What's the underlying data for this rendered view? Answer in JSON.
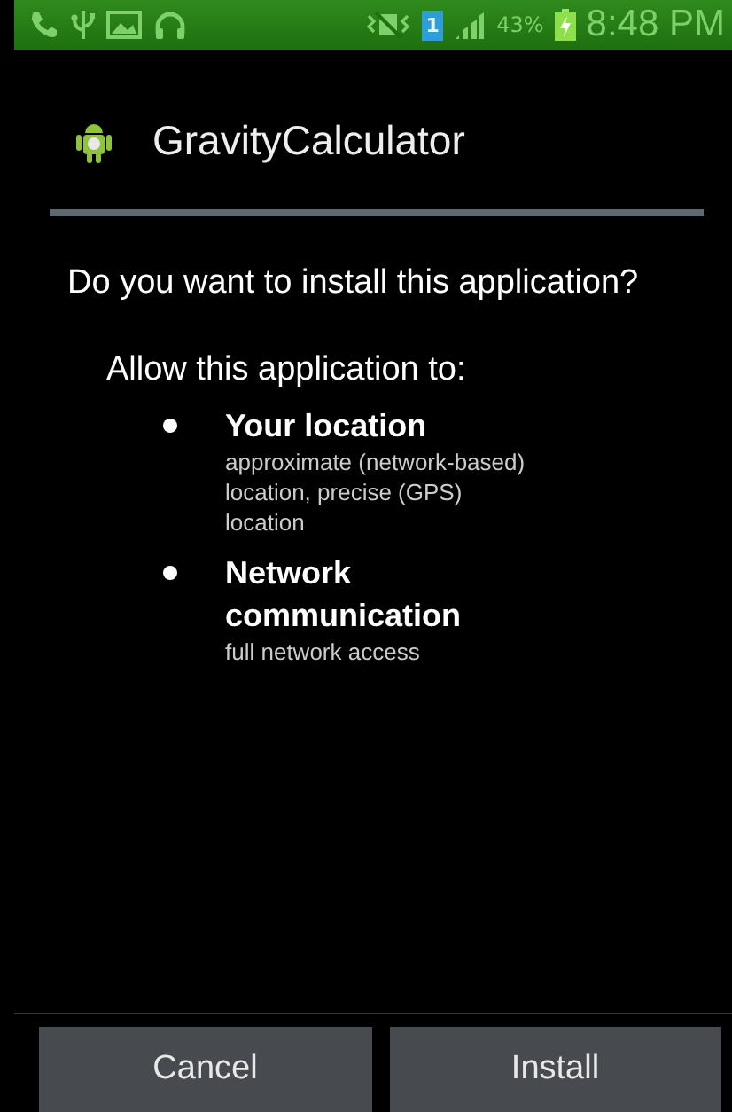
{
  "status_bar": {
    "sim_label": "1",
    "battery_percent": "43%",
    "time": "8:48 PM"
  },
  "dialog": {
    "app_name": "GravityCalculator",
    "question": "Do you want to install this application?",
    "permissions_heading": "Allow this application to:",
    "permissions": [
      {
        "title": "Your location",
        "detail": "approximate (network-based) location, precise (GPS) location"
      },
      {
        "title": "Network communication",
        "detail": "full network access"
      }
    ],
    "buttons": [
      "Cancel",
      "Install"
    ]
  }
}
